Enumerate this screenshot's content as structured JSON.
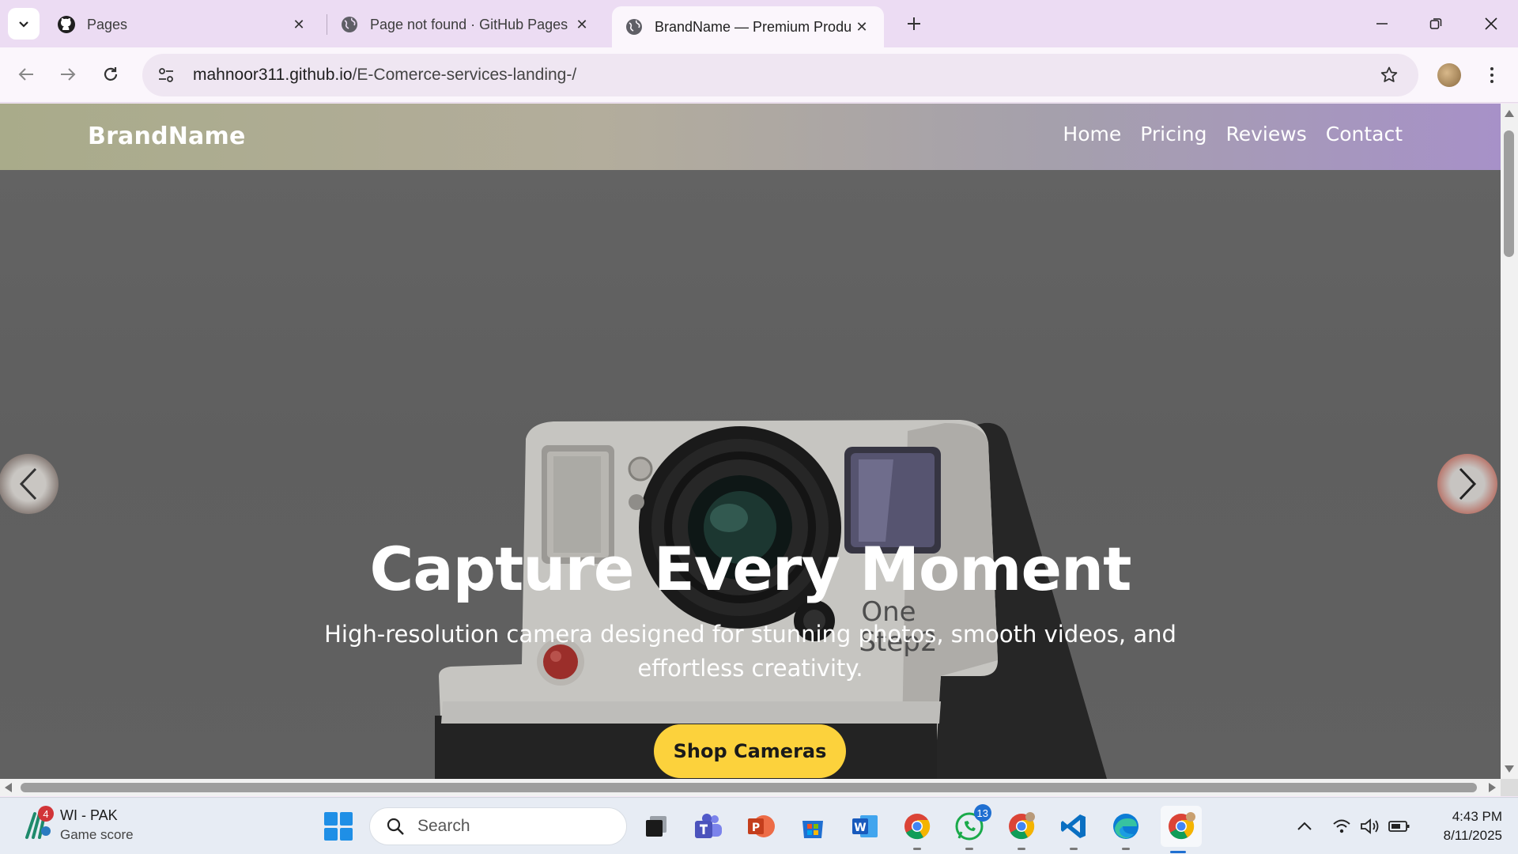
{
  "browser": {
    "tabs": [
      {
        "title": "Pages",
        "icon": "github-icon"
      },
      {
        "title": "Page not found · GitHub Pages",
        "icon": "globe-icon"
      },
      {
        "title": "BrandName — Premium Products",
        "icon": "globe-icon",
        "active": true
      }
    ],
    "url_host": "mahnoor311.github.io",
    "url_path": "/E-Comerce-services-landing-/"
  },
  "site": {
    "brand": "BrandName",
    "nav": [
      "Home",
      "Pricing",
      "Reviews",
      "Contact"
    ],
    "hero": {
      "title": "Capture Every Moment",
      "subtitle": "High-resolution camera designed for stunning photos, smooth videos, and effortless creativity.",
      "cta": "Shop Cameras",
      "camera_text_1": "One",
      "camera_text_2": "Step2"
    },
    "colors": {
      "cta": "#fcd23c",
      "nav_start": "#a9ab8a",
      "nav_end": "#a791c8"
    }
  },
  "taskbar": {
    "widget_title": "WI - PAK",
    "widget_sub": "Game score",
    "widget_badge": "4",
    "search_placeholder": "Search",
    "whatsapp_badge": "13",
    "time": "4:43 PM",
    "date": "8/11/2025"
  }
}
